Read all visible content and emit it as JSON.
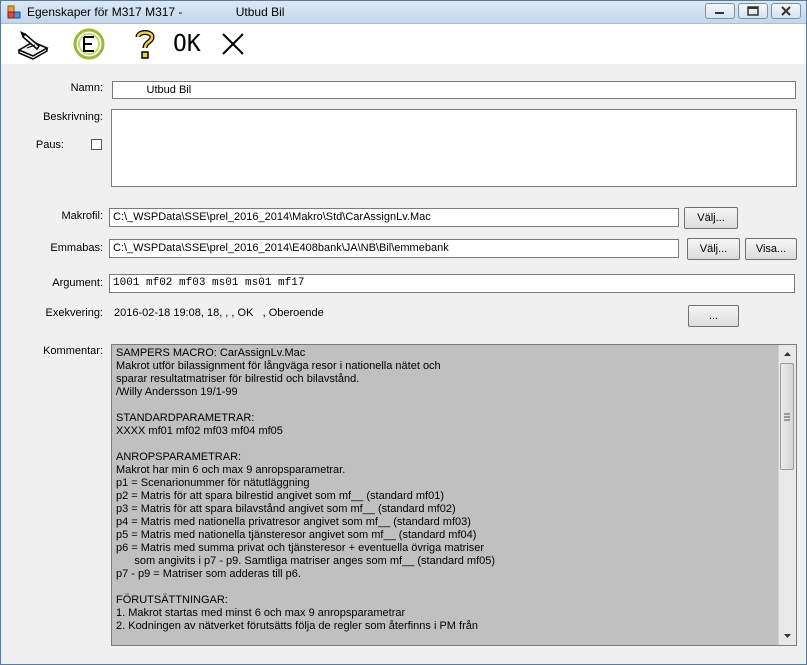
{
  "window": {
    "title": "Egenskaper för M317 M317 -                Utbud Bil"
  },
  "toolbar": {
    "ok_label": "OK"
  },
  "form": {
    "namn_label": "Namn:",
    "namn_value": "          Utbud Bil",
    "beskrivning_label": "Beskrivning:",
    "beskrivning_value": "",
    "paus_label": "Paus:",
    "makrofil_label": "Makrofil:",
    "makrofil_value": "C:\\_WSPData\\SSE\\prel_2016_2014\\Makro\\Std\\CarAssignLv.Mac",
    "makrofil_button": "Välj...",
    "emmabas_label": "Emmabas:",
    "emmabas_value": "C:\\_WSPData\\SSE\\prel_2016_2014\\E408bank\\JA\\NB\\Bil\\emmebank",
    "emmabas_button": "Välj...",
    "visa_button": "Visa...",
    "argument_label": "Argument:",
    "argument_value": "1001 mf02 mf03 ms01 ms01 mf17",
    "exekvering_label": "Exekvering:",
    "exekvering_value": "2016-02-18 19:08, 18, , , OK   , Oberoende",
    "exekvering_button": "...",
    "kommentar_label": "Kommentar:",
    "kommentar_lines": [
      "SAMPERS MACRO: CarAssignLv.Mac",
      "Makrot utför bilassignment för långväga resor i nationella nätet och",
      "sparar resultatmatriser för bilrestid och bilavstånd.",
      "/Willy Andersson 19/1-99",
      "",
      "STANDARDPARAMETRAR:",
      "XXXX mf01 mf02 mf03 mf04 mf05",
      "",
      "ANROPSPARAMETRAR:",
      "Makrot har min 6 och max 9 anropsparametrar.",
      "p1 = Scenarionummer för nätutläggning",
      "p2 = Matris för att spara bilrestid angivet som mf__ (standard mf01)",
      "p3 = Matris för att spara bilavstånd angivet som mf__ (standard mf02)",
      "p4 = Matris med nationella privatresor angivet som mf__ (standard mf03)",
      "p5 = Matris med nationella tjänsteresor angivet som mf__ (standard mf04)",
      "p6 = Matris med summa privat och tjänsteresor + eventuella övriga matriser",
      "      som angivits i p7 - p9. Samtliga matriser anges som mf__ (standard mf05)",
      "p7 - p9 = Matriser som adderas till p6.",
      "",
      "FÖRUTSÄTTNINGAR:",
      "1. Makrot startas med minst 6 och max 9 anropsparametrar",
      "2. Kodningen av nätverket förutsätts följa de regler som återfinns i PM från"
    ]
  }
}
